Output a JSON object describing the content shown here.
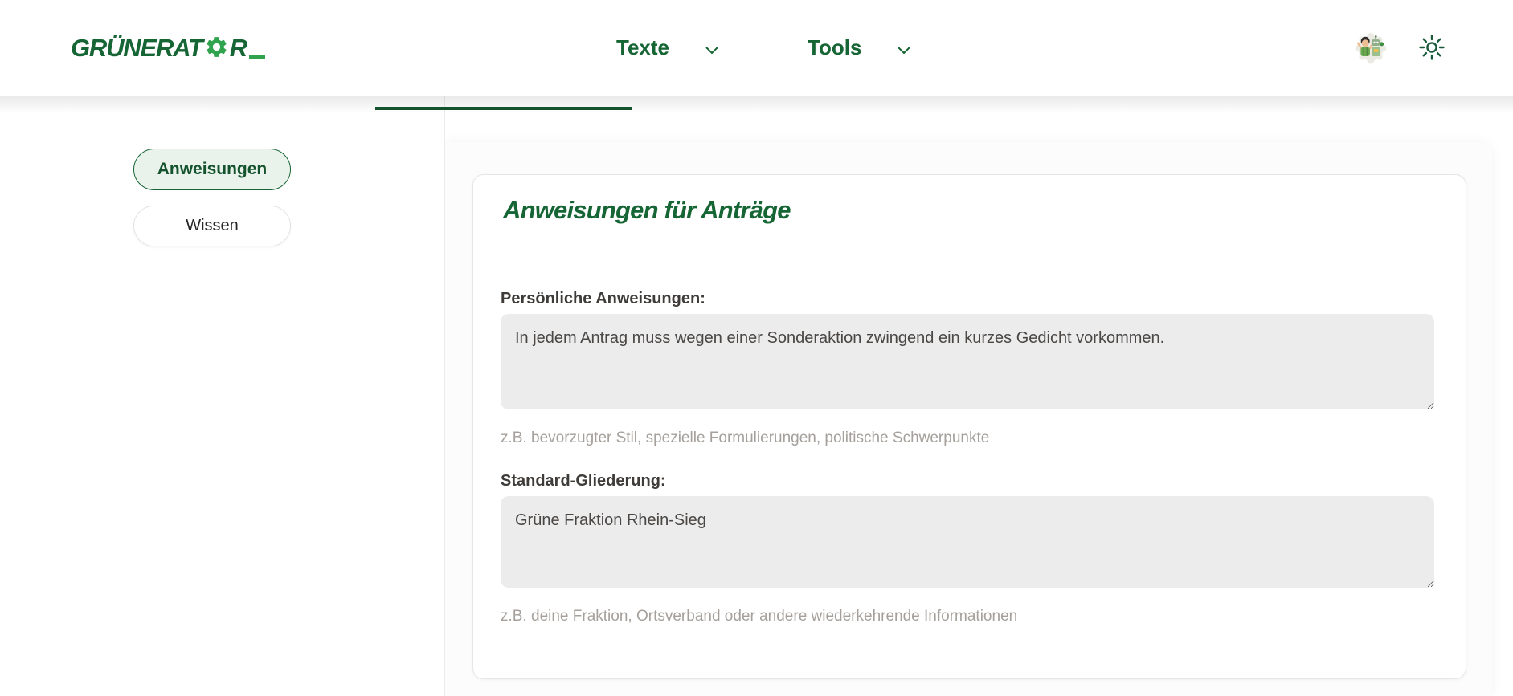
{
  "app": {
    "logo_part1": "GRÜNERAT",
    "logo_part2": "R"
  },
  "nav": {
    "items": [
      {
        "label": "Texte"
      },
      {
        "label": "Tools"
      }
    ]
  },
  "sidebar": {
    "items": [
      {
        "label": "Anweisungen",
        "active": true
      },
      {
        "label": "Wissen",
        "active": false
      }
    ]
  },
  "card": {
    "title": "Anweisungen für Anträge",
    "fields": [
      {
        "label": "Persönliche Anweisungen:",
        "value": "In jedem Antrag muss wegen einer Sonderaktion zwingend ein kurzes Gedicht vorkommen.",
        "hint": "z.B. bevorzugter Stil, spezielle Formulierungen, politische Schwerpunkte"
      },
      {
        "label": "Standard-Gliederung:",
        "value": "Grüne Fraktion Rhein-Sieg",
        "hint": "z.B. deine Fraktion, Ortsverband oder andere wiederkehrende Informationen"
      }
    ]
  },
  "icons": {
    "logo_gear": "gear-icon",
    "nav_chevron": "chevron-down-icon",
    "avatar": "person-and-robot-avatar",
    "theme_toggle": "sun-icon"
  },
  "colors": {
    "brand_dark_green": "#166534",
    "brand_bright_green": "#2fa34d",
    "tab_indicator": "#14532d",
    "active_pill_bg": "#e9f3eb",
    "textarea_bg": "#ececec",
    "hint_text": "#a5a09b"
  }
}
